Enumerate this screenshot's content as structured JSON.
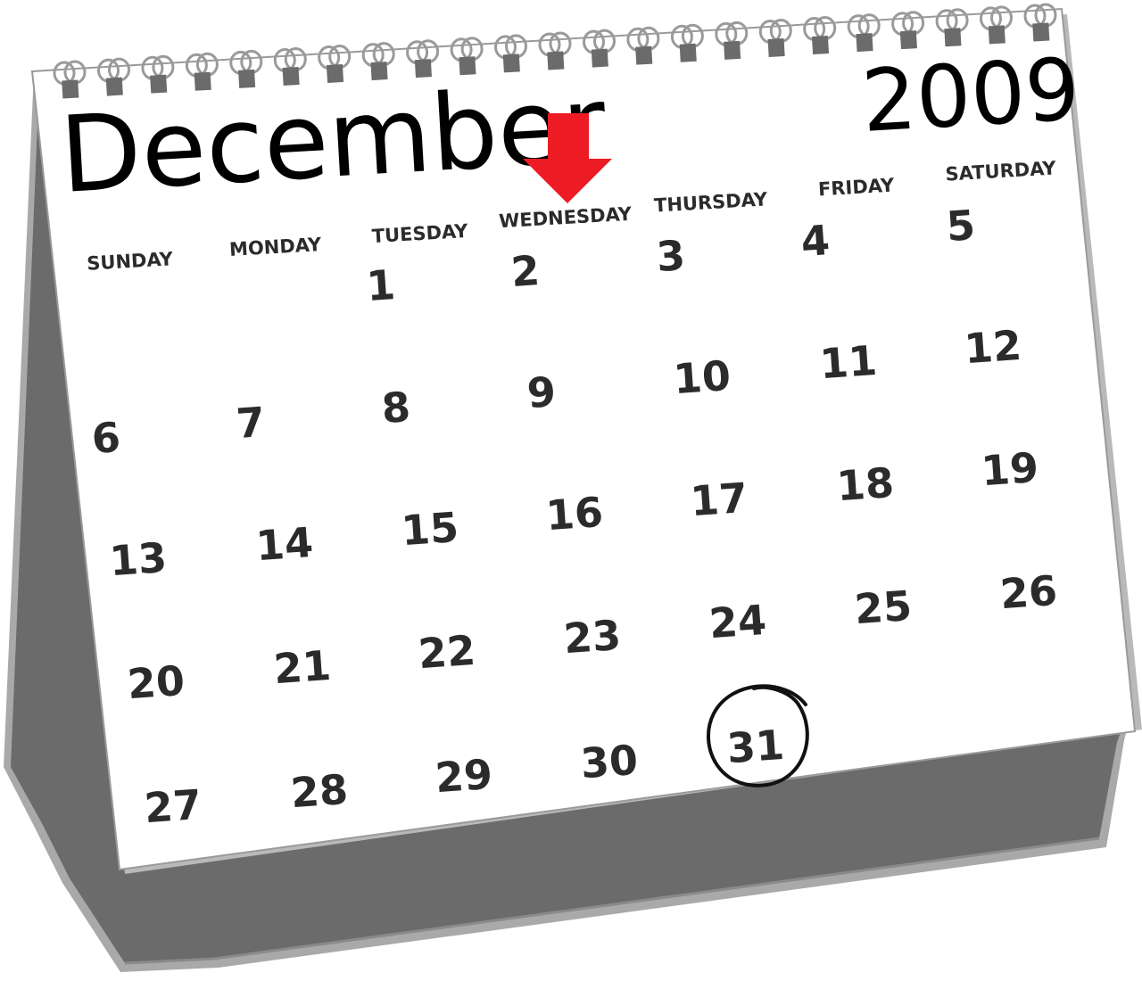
{
  "calendar": {
    "month": "December",
    "year": "2009",
    "weekdays": [
      "SUNDAY",
      "MONDAY",
      "TUESDAY",
      "WEDNESDAY",
      "THURSDAY",
      "FRIDAY",
      "SATURDAY"
    ],
    "weeks": [
      [
        "",
        "",
        "1",
        "2",
        "3",
        "4",
        "5"
      ],
      [
        "6",
        "7",
        "8",
        "9",
        "10",
        "11",
        "12"
      ],
      [
        "13",
        "14",
        "15",
        "16",
        "17",
        "18",
        "19"
      ],
      [
        "20",
        "21",
        "22",
        "23",
        "24",
        "25",
        "26"
      ],
      [
        "27",
        "28",
        "29",
        "30",
        "31",
        "",
        ""
      ]
    ],
    "circled_day": "31",
    "arrow_points_to": "WEDNESDAY"
  },
  "colors": {
    "arrow": "#ed1c24",
    "stand": "#6b6b6b",
    "stand_edge": "#a9a9a9",
    "page": "#ffffff",
    "text": "#2b2b2b"
  },
  "icons": {
    "arrow": "down-arrow-icon",
    "circle": "circle-mark-icon",
    "binding": "spiral-binding-icon"
  }
}
